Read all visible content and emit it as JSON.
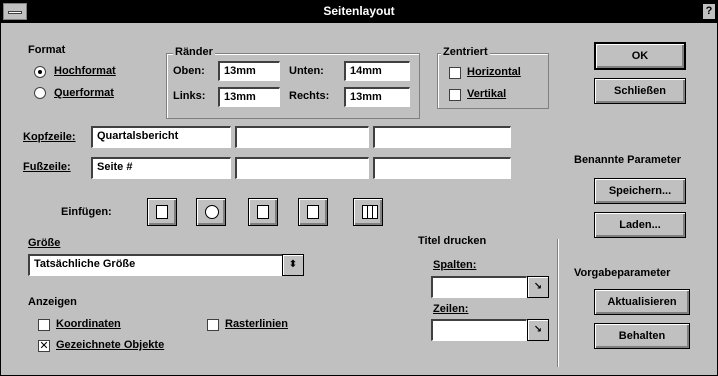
{
  "window": {
    "title": "Seitenlayout",
    "help": "?"
  },
  "format": {
    "label": "Format",
    "portrait": "Hochformat",
    "landscape": "Querformat",
    "selected": "Hochformat"
  },
  "margins": {
    "label": "Ränder",
    "top_label": "Oben:",
    "top_value": "13mm",
    "left_label": "Links:",
    "left_value": "13mm",
    "bottom_label": "Unten:",
    "bottom_value": "14mm",
    "right_label": "Rechts:",
    "right_value": "13mm"
  },
  "center": {
    "label": "Zentriert",
    "horizontal": "Horizontal",
    "vertical": "Vertikal"
  },
  "header": {
    "label": "Kopfzeile:",
    "fields": [
      "Quartalsbericht",
      "",
      ""
    ]
  },
  "footer": {
    "label": "Fußzeile:",
    "fields": [
      "Seite #",
      "",
      ""
    ]
  },
  "insert": {
    "label": "Einfügen:",
    "icons": [
      "page-number-icon",
      "clock-icon",
      "date-icon",
      "page-count-icon",
      "grid-icon"
    ]
  },
  "size": {
    "label": "Größe",
    "value": "Tatsächliche Größe",
    "arrow": "⬍"
  },
  "display": {
    "label": "Anzeigen",
    "coordinates": "Koordinaten",
    "gridlines": "Rasterlinien",
    "drawn_objects": "Gezeichnete Objekte",
    "drawn_objects_checked": "✕"
  },
  "print_titles": {
    "label": "Titel drucken",
    "columns_label": "Spalten:",
    "rows_label": "Zeilen:",
    "columns_value": "",
    "rows_value": ""
  },
  "buttons": {
    "ok": "OK",
    "close": "Schließen",
    "save": "Speichern...",
    "load": "Laden...",
    "update": "Aktualisieren",
    "keep": "Behalten"
  },
  "named_params": {
    "label": "Benannte Parameter"
  },
  "default_params": {
    "label": "Vorgabeparameter"
  }
}
